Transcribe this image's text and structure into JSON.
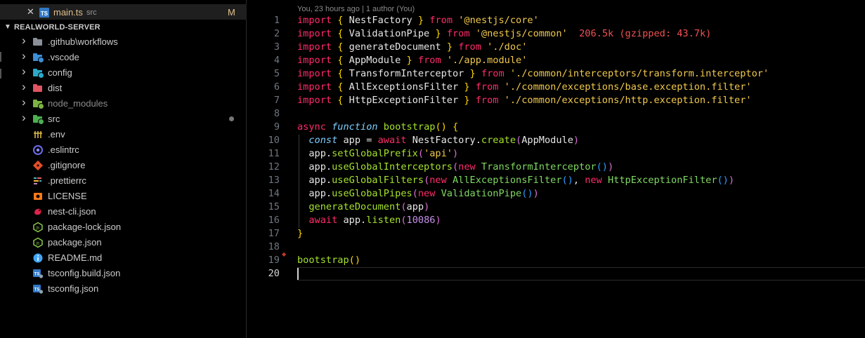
{
  "open_editor": {
    "close_glyph": "✕",
    "icon": "typescript-file-icon",
    "filename": "main.ts",
    "dir": "src",
    "status": "M"
  },
  "explorer": {
    "root_label": "REALWORLD-SERVER",
    "items": [
      {
        "label": ".github\\workflows",
        "kind": "folder",
        "color": "#8a8f98",
        "badge": ""
      },
      {
        "label": ".vscode",
        "kind": "folder",
        "color": "#3d8fd6",
        "badge": "#3d8fd6"
      },
      {
        "label": "config",
        "kind": "folder",
        "color": "#2aa9c9",
        "badge": "#2aa9c9"
      },
      {
        "label": "dist",
        "kind": "folder",
        "color": "#e05561",
        "badge": ""
      },
      {
        "label": "node_modules",
        "kind": "folder",
        "color": "#7cb342",
        "badge": "#7cb342"
      },
      {
        "label": "src",
        "kind": "folder",
        "color": "#4caf50",
        "badge": "#4caf50"
      },
      {
        "label": ".env",
        "kind": "file",
        "icon": "env-icon"
      },
      {
        "label": ".eslintrc",
        "kind": "file",
        "icon": "eslint-icon"
      },
      {
        "label": ".gitignore",
        "kind": "file",
        "icon": "git-icon"
      },
      {
        "label": ".prettierrc",
        "kind": "file",
        "icon": "prettier-icon"
      },
      {
        "label": "LICENSE",
        "kind": "file",
        "icon": "license-icon"
      },
      {
        "label": "nest-cli.json",
        "kind": "file",
        "icon": "nestjs-icon"
      },
      {
        "label": "package-lock.json",
        "kind": "file",
        "icon": "nodejs-icon"
      },
      {
        "label": "package.json",
        "kind": "file",
        "icon": "nodejs-icon"
      },
      {
        "label": "README.md",
        "kind": "file",
        "icon": "info-icon"
      },
      {
        "label": "tsconfig.build.json",
        "kind": "file",
        "icon": "tsconfig-icon"
      },
      {
        "label": "tsconfig.json",
        "kind": "file",
        "icon": "tsconfig-icon"
      }
    ]
  },
  "editor": {
    "blame": "You, 23 hours ago | 1 author (You)",
    "current_line": 20,
    "lines": [
      [
        [
          "kw",
          "import"
        ],
        [
          "pl",
          " "
        ],
        [
          "br1",
          "{"
        ],
        [
          "pl",
          " NestFactory "
        ],
        [
          "br1",
          "}"
        ],
        [
          "pl",
          " "
        ],
        [
          "kw",
          "from"
        ],
        [
          "pl",
          " "
        ],
        [
          "str",
          "'@nestjs/core'"
        ]
      ],
      [
        [
          "kw",
          "import"
        ],
        [
          "pl",
          " "
        ],
        [
          "br1",
          "{"
        ],
        [
          "pl",
          " ValidationPipe "
        ],
        [
          "br1",
          "}"
        ],
        [
          "pl",
          " "
        ],
        [
          "kw",
          "from"
        ],
        [
          "pl",
          " "
        ],
        [
          "str",
          "'@nestjs/common'"
        ],
        [
          "pl",
          "  "
        ],
        [
          "size",
          "206.5k (gzipped: 43.7k)"
        ]
      ],
      [
        [
          "kw",
          "import"
        ],
        [
          "pl",
          " "
        ],
        [
          "br1",
          "{"
        ],
        [
          "pl",
          " generateDocument "
        ],
        [
          "br1",
          "}"
        ],
        [
          "pl",
          " "
        ],
        [
          "kw",
          "from"
        ],
        [
          "pl",
          " "
        ],
        [
          "str",
          "'./doc'"
        ]
      ],
      [
        [
          "kw",
          "import"
        ],
        [
          "pl",
          " "
        ],
        [
          "br1",
          "{"
        ],
        [
          "pl",
          " AppModule "
        ],
        [
          "br1",
          "}"
        ],
        [
          "pl",
          " "
        ],
        [
          "kw",
          "from"
        ],
        [
          "pl",
          " "
        ],
        [
          "str",
          "'./app.module'"
        ]
      ],
      [
        [
          "kw",
          "import"
        ],
        [
          "pl",
          " "
        ],
        [
          "br1",
          "{"
        ],
        [
          "pl",
          " TransformInterceptor "
        ],
        [
          "br1",
          "}"
        ],
        [
          "pl",
          " "
        ],
        [
          "kw",
          "from"
        ],
        [
          "pl",
          " "
        ],
        [
          "str",
          "'./common/interceptors/transform.interceptor'"
        ]
      ],
      [
        [
          "kw",
          "import"
        ],
        [
          "pl",
          " "
        ],
        [
          "br1",
          "{"
        ],
        [
          "pl",
          " AllExceptionsFilter "
        ],
        [
          "br1",
          "}"
        ],
        [
          "pl",
          " "
        ],
        [
          "kw",
          "from"
        ],
        [
          "pl",
          " "
        ],
        [
          "str",
          "'./common/exceptions/base.exception.filter'"
        ]
      ],
      [
        [
          "kw",
          "import"
        ],
        [
          "pl",
          " "
        ],
        [
          "br1",
          "{"
        ],
        [
          "pl",
          " HttpExceptionFilter "
        ],
        [
          "br1",
          "}"
        ],
        [
          "pl",
          " "
        ],
        [
          "kw",
          "from"
        ],
        [
          "pl",
          " "
        ],
        [
          "str",
          "'./common/exceptions/http.exception.filter'"
        ]
      ],
      [],
      [
        [
          "kw",
          "async"
        ],
        [
          "pl",
          " "
        ],
        [
          "fnk",
          "function"
        ],
        [
          "pl",
          " "
        ],
        [
          "fn",
          "bootstrap"
        ],
        [
          "br1",
          "()"
        ],
        [
          "pl",
          " "
        ],
        [
          "br1",
          "{"
        ]
      ],
      [
        [
          "pl",
          "  "
        ],
        [
          "dcl",
          "const"
        ],
        [
          "pl",
          " app = "
        ],
        [
          "ctl",
          "await"
        ],
        [
          "pl",
          " NestFactory."
        ],
        [
          "fn",
          "create"
        ],
        [
          "br2",
          "("
        ],
        [
          "pl",
          "AppModule"
        ],
        [
          "br2",
          ")"
        ]
      ],
      [
        [
          "pl",
          "  app."
        ],
        [
          "fn",
          "setGlobalPrefix"
        ],
        [
          "br2",
          "("
        ],
        [
          "str",
          "'api'"
        ],
        [
          "br2",
          ")"
        ]
      ],
      [
        [
          "pl",
          "  app."
        ],
        [
          "fn",
          "useGlobalInterceptors"
        ],
        [
          "br2",
          "("
        ],
        [
          "kw",
          "new"
        ],
        [
          "pl",
          " "
        ],
        [
          "cls",
          "TransformInterceptor"
        ],
        [
          "br3",
          "()"
        ],
        [
          "br2",
          ")"
        ]
      ],
      [
        [
          "pl",
          "  app."
        ],
        [
          "fn",
          "useGlobalFilters"
        ],
        [
          "br2",
          "("
        ],
        [
          "kw",
          "new"
        ],
        [
          "pl",
          " "
        ],
        [
          "cls",
          "AllExceptionsFilter"
        ],
        [
          "br3",
          "()"
        ],
        [
          "pl",
          ", "
        ],
        [
          "kw",
          "new"
        ],
        [
          "pl",
          " "
        ],
        [
          "cls",
          "HttpExceptionFilter"
        ],
        [
          "br3",
          "()"
        ],
        [
          "br2",
          ")"
        ]
      ],
      [
        [
          "pl",
          "  app."
        ],
        [
          "fn",
          "useGlobalPipes"
        ],
        [
          "br2",
          "("
        ],
        [
          "kw",
          "new"
        ],
        [
          "pl",
          " "
        ],
        [
          "cls",
          "ValidationPipe"
        ],
        [
          "br3",
          "()"
        ],
        [
          "br2",
          ")"
        ]
      ],
      [
        [
          "pl",
          "  "
        ],
        [
          "fn",
          "generateDocument"
        ],
        [
          "br2",
          "("
        ],
        [
          "pl",
          "app"
        ],
        [
          "br2",
          ")"
        ]
      ],
      [
        [
          "pl",
          "  "
        ],
        [
          "ctl",
          "await"
        ],
        [
          "pl",
          " app."
        ],
        [
          "fn",
          "listen"
        ],
        [
          "br2",
          "("
        ],
        [
          "num",
          "10086"
        ],
        [
          "br2",
          ")"
        ]
      ],
      [
        [
          "br1",
          "}"
        ]
      ],
      [],
      [
        [
          "fn",
          "bootstrap"
        ],
        [
          "br1",
          "()"
        ]
      ],
      []
    ]
  }
}
